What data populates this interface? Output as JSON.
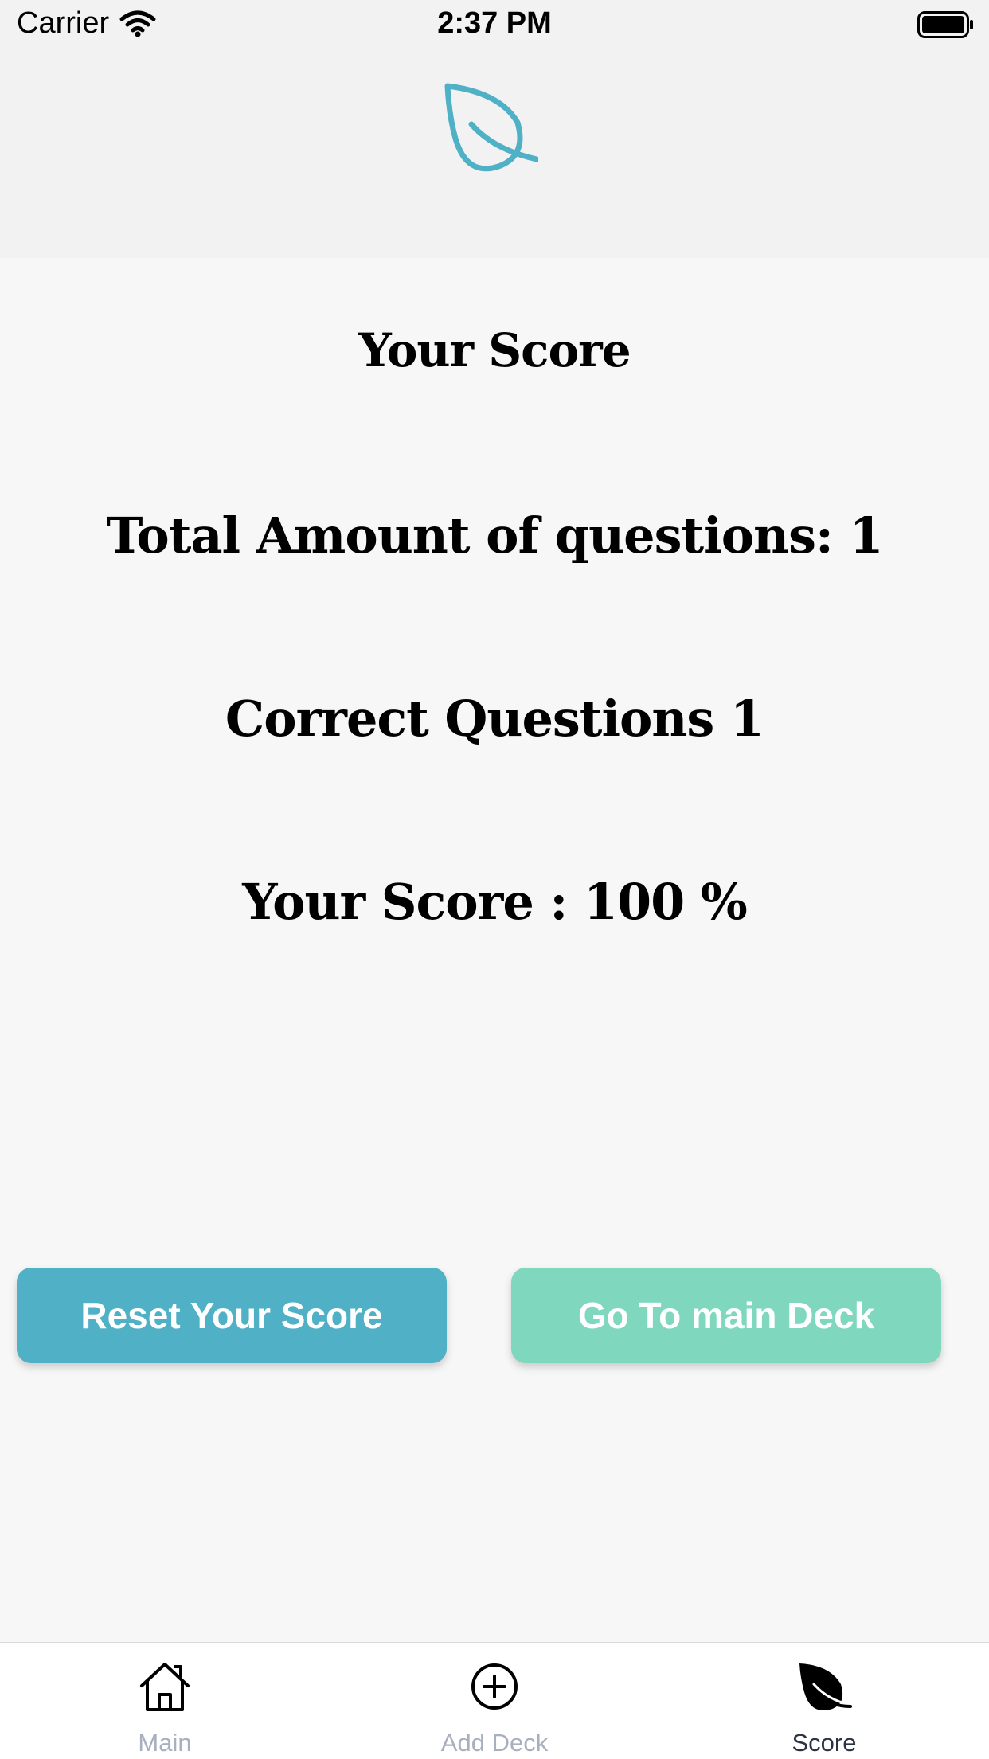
{
  "status_bar": {
    "carrier": "Carrier",
    "time": "2:37 PM"
  },
  "header": {
    "logo_icon": "leaf-icon",
    "logo_color": "#4fb0c6"
  },
  "score_screen": {
    "title": "Your Score",
    "total_questions": "Total Amount of questions: 1",
    "correct_questions": "Correct Questions 1",
    "score_percent": "Your Score : 100 %"
  },
  "buttons": {
    "reset_label": "Reset Your Score",
    "reset_color": "#4fb0c6",
    "main_deck_label": "Go To main Deck",
    "main_deck_color": "#7fd8be"
  },
  "tab_bar": {
    "items": [
      {
        "label": "Main",
        "icon": "home-icon"
      },
      {
        "label": "Add Deck",
        "icon": "plus-circle-icon"
      },
      {
        "label": "Score",
        "icon": "leaf-icon"
      }
    ],
    "active": "Score"
  }
}
